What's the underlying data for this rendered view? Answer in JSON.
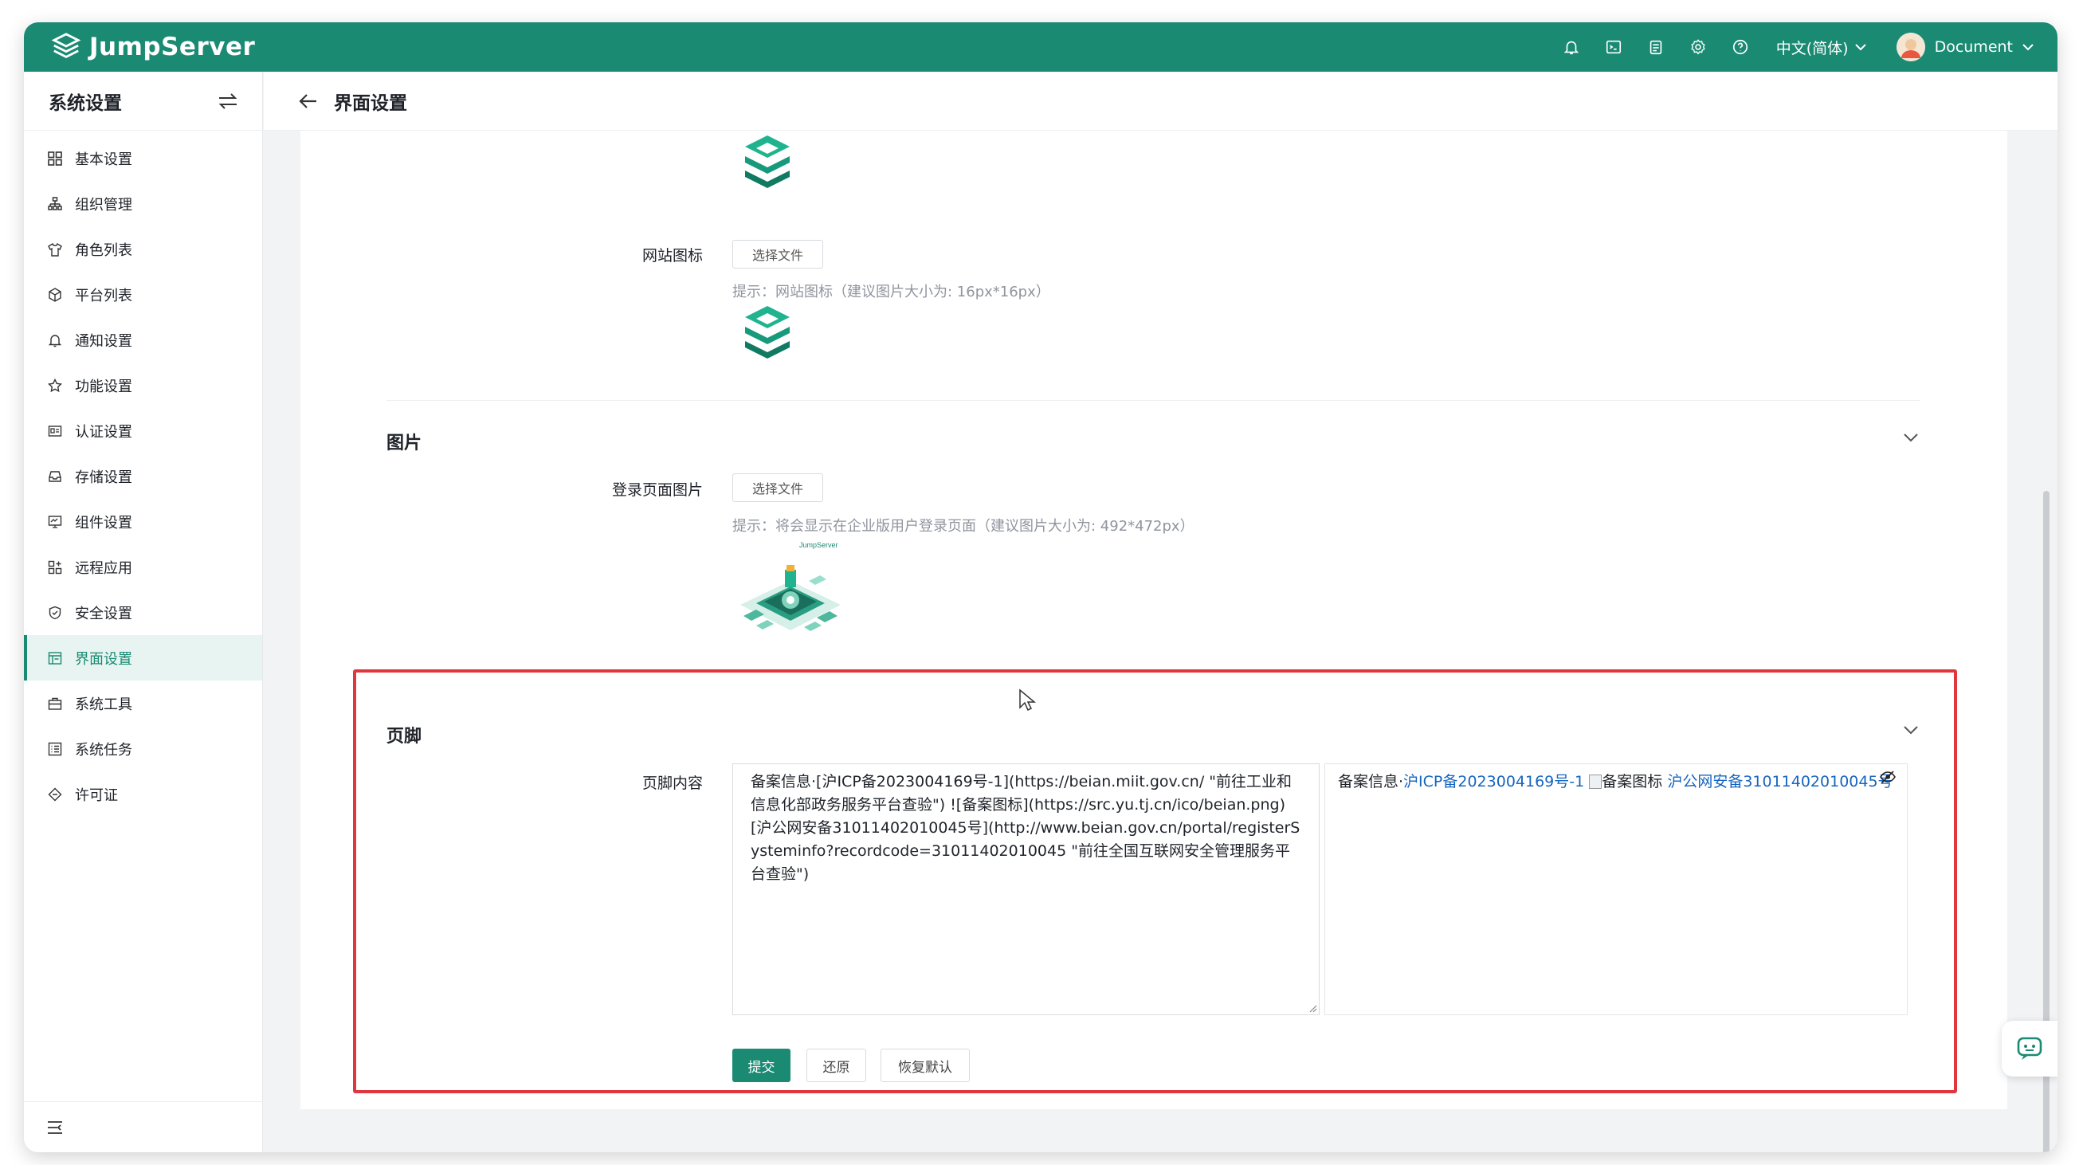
{
  "header": {
    "brand": "JumpServer",
    "language": "中文(简体)",
    "user": "Document",
    "icons": [
      "bell-icon",
      "terminal-icon",
      "clipboard-icon",
      "gear-icon",
      "help-icon"
    ]
  },
  "sidebar": {
    "title": "系统设置",
    "items": [
      {
        "label": "基本设置",
        "icon": "grid-icon"
      },
      {
        "label": "组织管理",
        "icon": "org-icon"
      },
      {
        "label": "角色列表",
        "icon": "shirt-icon"
      },
      {
        "label": "平台列表",
        "icon": "cube-icon"
      },
      {
        "label": "通知设置",
        "icon": "bell-icon"
      },
      {
        "label": "功能设置",
        "icon": "star-icon"
      },
      {
        "label": "认证设置",
        "icon": "id-card-icon"
      },
      {
        "label": "存储设置",
        "icon": "inbox-icon"
      },
      {
        "label": "组件设置",
        "icon": "monitor-icon"
      },
      {
        "label": "远程应用",
        "icon": "apps-icon"
      },
      {
        "label": "安全设置",
        "icon": "shield-icon"
      },
      {
        "label": "界面设置",
        "icon": "layout-icon"
      },
      {
        "label": "系统工具",
        "icon": "toolbox-icon"
      },
      {
        "label": "系统任务",
        "icon": "tasks-icon"
      },
      {
        "label": "许可证",
        "icon": "license-icon"
      }
    ],
    "active_index": 11
  },
  "page": {
    "title": "界面设置"
  },
  "form": {
    "favicon_label": "网站图标",
    "choose_file": "选择文件",
    "favicon_hint": "提示：网站图标（建议图片大小为: 16px*16px）",
    "image_section": "图片",
    "login_image_label": "登录页面图片",
    "login_image_hint": "提示：将会显示在企业版用户登录页面（建议图片大小为: 492*472px）",
    "login_image_brand": "JumpServer",
    "footer_section": "页脚",
    "footer_label": "页脚内容",
    "footer_text": "备案信息·[沪ICP备2023004169号-1](https://beian.miit.gov.cn/ \"前往工业和信息化部政务服务平台查验\") ![备案图标](https://src.yu.tj.cn/ico/beian.png) [沪公网安备31011402010045号](http://www.beian.gov.cn/portal/registerSysteminfo?recordcode=31011402010045 \"前往全国互联网安全管理服务平台查验\")",
    "preview": {
      "prefix": "备案信息·",
      "link1": "沪ICP备2023004169号-1",
      "img_alt": "备案图标",
      "link2": "沪公网安备31011402010045号"
    },
    "buttons": {
      "submit": "提交",
      "reset": "还原",
      "restore_default": "恢复默认"
    }
  },
  "colors": {
    "brand": "#1a8a73",
    "highlight": "#e0363d",
    "link": "#1565c0"
  }
}
